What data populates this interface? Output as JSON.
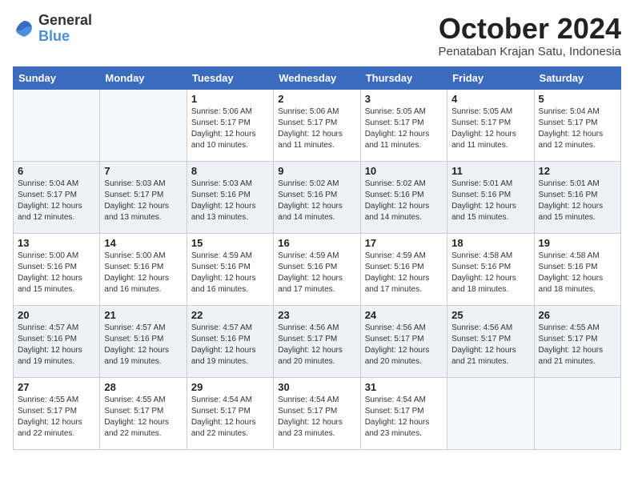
{
  "logo": {
    "general": "General",
    "blue": "Blue"
  },
  "header": {
    "month": "October 2024",
    "location": "Penataban Krajan Satu, Indonesia"
  },
  "days_of_week": [
    "Sunday",
    "Monday",
    "Tuesday",
    "Wednesday",
    "Thursday",
    "Friday",
    "Saturday"
  ],
  "weeks": [
    [
      {
        "day": "",
        "info": ""
      },
      {
        "day": "",
        "info": ""
      },
      {
        "day": "1",
        "info": "Sunrise: 5:06 AM\nSunset: 5:17 PM\nDaylight: 12 hours\nand 10 minutes."
      },
      {
        "day": "2",
        "info": "Sunrise: 5:06 AM\nSunset: 5:17 PM\nDaylight: 12 hours\nand 11 minutes."
      },
      {
        "day": "3",
        "info": "Sunrise: 5:05 AM\nSunset: 5:17 PM\nDaylight: 12 hours\nand 11 minutes."
      },
      {
        "day": "4",
        "info": "Sunrise: 5:05 AM\nSunset: 5:17 PM\nDaylight: 12 hours\nand 11 minutes."
      },
      {
        "day": "5",
        "info": "Sunrise: 5:04 AM\nSunset: 5:17 PM\nDaylight: 12 hours\nand 12 minutes."
      }
    ],
    [
      {
        "day": "6",
        "info": "Sunrise: 5:04 AM\nSunset: 5:17 PM\nDaylight: 12 hours\nand 12 minutes."
      },
      {
        "day": "7",
        "info": "Sunrise: 5:03 AM\nSunset: 5:17 PM\nDaylight: 12 hours\nand 13 minutes."
      },
      {
        "day": "8",
        "info": "Sunrise: 5:03 AM\nSunset: 5:16 PM\nDaylight: 12 hours\nand 13 minutes."
      },
      {
        "day": "9",
        "info": "Sunrise: 5:02 AM\nSunset: 5:16 PM\nDaylight: 12 hours\nand 14 minutes."
      },
      {
        "day": "10",
        "info": "Sunrise: 5:02 AM\nSunset: 5:16 PM\nDaylight: 12 hours\nand 14 minutes."
      },
      {
        "day": "11",
        "info": "Sunrise: 5:01 AM\nSunset: 5:16 PM\nDaylight: 12 hours\nand 15 minutes."
      },
      {
        "day": "12",
        "info": "Sunrise: 5:01 AM\nSunset: 5:16 PM\nDaylight: 12 hours\nand 15 minutes."
      }
    ],
    [
      {
        "day": "13",
        "info": "Sunrise: 5:00 AM\nSunset: 5:16 PM\nDaylight: 12 hours\nand 15 minutes."
      },
      {
        "day": "14",
        "info": "Sunrise: 5:00 AM\nSunset: 5:16 PM\nDaylight: 12 hours\nand 16 minutes."
      },
      {
        "day": "15",
        "info": "Sunrise: 4:59 AM\nSunset: 5:16 PM\nDaylight: 12 hours\nand 16 minutes."
      },
      {
        "day": "16",
        "info": "Sunrise: 4:59 AM\nSunset: 5:16 PM\nDaylight: 12 hours\nand 17 minutes."
      },
      {
        "day": "17",
        "info": "Sunrise: 4:59 AM\nSunset: 5:16 PM\nDaylight: 12 hours\nand 17 minutes."
      },
      {
        "day": "18",
        "info": "Sunrise: 4:58 AM\nSunset: 5:16 PM\nDaylight: 12 hours\nand 18 minutes."
      },
      {
        "day": "19",
        "info": "Sunrise: 4:58 AM\nSunset: 5:16 PM\nDaylight: 12 hours\nand 18 minutes."
      }
    ],
    [
      {
        "day": "20",
        "info": "Sunrise: 4:57 AM\nSunset: 5:16 PM\nDaylight: 12 hours\nand 19 minutes."
      },
      {
        "day": "21",
        "info": "Sunrise: 4:57 AM\nSunset: 5:16 PM\nDaylight: 12 hours\nand 19 minutes."
      },
      {
        "day": "22",
        "info": "Sunrise: 4:57 AM\nSunset: 5:16 PM\nDaylight: 12 hours\nand 19 minutes."
      },
      {
        "day": "23",
        "info": "Sunrise: 4:56 AM\nSunset: 5:17 PM\nDaylight: 12 hours\nand 20 minutes."
      },
      {
        "day": "24",
        "info": "Sunrise: 4:56 AM\nSunset: 5:17 PM\nDaylight: 12 hours\nand 20 minutes."
      },
      {
        "day": "25",
        "info": "Sunrise: 4:56 AM\nSunset: 5:17 PM\nDaylight: 12 hours\nand 21 minutes."
      },
      {
        "day": "26",
        "info": "Sunrise: 4:55 AM\nSunset: 5:17 PM\nDaylight: 12 hours\nand 21 minutes."
      }
    ],
    [
      {
        "day": "27",
        "info": "Sunrise: 4:55 AM\nSunset: 5:17 PM\nDaylight: 12 hours\nand 22 minutes."
      },
      {
        "day": "28",
        "info": "Sunrise: 4:55 AM\nSunset: 5:17 PM\nDaylight: 12 hours\nand 22 minutes."
      },
      {
        "day": "29",
        "info": "Sunrise: 4:54 AM\nSunset: 5:17 PM\nDaylight: 12 hours\nand 22 minutes."
      },
      {
        "day": "30",
        "info": "Sunrise: 4:54 AM\nSunset: 5:17 PM\nDaylight: 12 hours\nand 23 minutes."
      },
      {
        "day": "31",
        "info": "Sunrise: 4:54 AM\nSunset: 5:17 PM\nDaylight: 12 hours\nand 23 minutes."
      },
      {
        "day": "",
        "info": ""
      },
      {
        "day": "",
        "info": ""
      }
    ]
  ]
}
